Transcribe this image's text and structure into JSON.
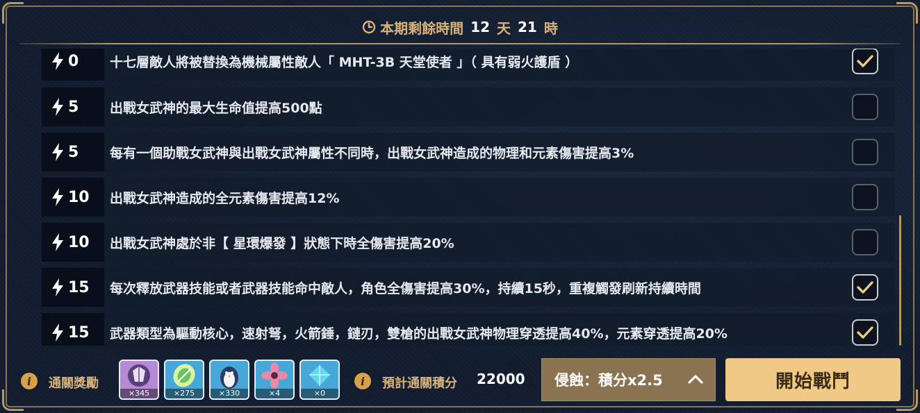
{
  "timer": {
    "prefix": "本期剩餘時間",
    "days": "12",
    "days_unit": "天",
    "hours": "21",
    "hours_unit": "時"
  },
  "modifiers": [
    {
      "cost": "0",
      "text": "十七層敵人將被替換為機械屬性敵人「 MHT-3B 天堂使者 」（ 具有弱火護盾 ）",
      "checked": true
    },
    {
      "cost": "5",
      "text": "出戰女武神的最大生命值提高500點",
      "checked": false
    },
    {
      "cost": "5",
      "text": "每有一個助戰女武神與出戰女武神屬性不同時，出戰女武神造成的物理和元素傷害提高3%",
      "checked": false
    },
    {
      "cost": "10",
      "text": "出戰女武神造成的全元素傷害提高12%",
      "checked": false
    },
    {
      "cost": "10",
      "text": "出戰女武神處於非【 星環爆發 】狀態下時全傷害提高20%",
      "checked": false
    },
    {
      "cost": "15",
      "text": "每次釋放武器技能或者武器技能命中敵人，角色全傷害提高30%，持續15秒，重複觸發刷新持續時間",
      "checked": true
    },
    {
      "cost": "15",
      "text": "武器類型為驅動核心，速射弩，火箭錘，鏈刃，雙槍的出戰女武神物理穿透提高40%，元素穿透提高20%",
      "checked": true
    }
  ],
  "footer": {
    "rewards_label": "通關獎勵",
    "rewards": [
      {
        "icon": "crystal-item-icon",
        "count": "×345"
      },
      {
        "icon": "disc-item-icon",
        "count": "×275"
      },
      {
        "icon": "penguin-item-icon",
        "count": "×330"
      },
      {
        "icon": "flower-item-icon",
        "count": "×4"
      },
      {
        "icon": "diamond-item-icon",
        "count": "×0"
      }
    ],
    "score_label": "預計通關積分",
    "score_value": "22000",
    "erosion_label": "侵蝕：積分x2.5",
    "start_button": "開始戰鬥"
  },
  "colors": {
    "accent_gold": "#d8b27a",
    "start_button": "#f1c987",
    "erosion_button": "#8a7350",
    "info_icon": "#d9a24a"
  }
}
